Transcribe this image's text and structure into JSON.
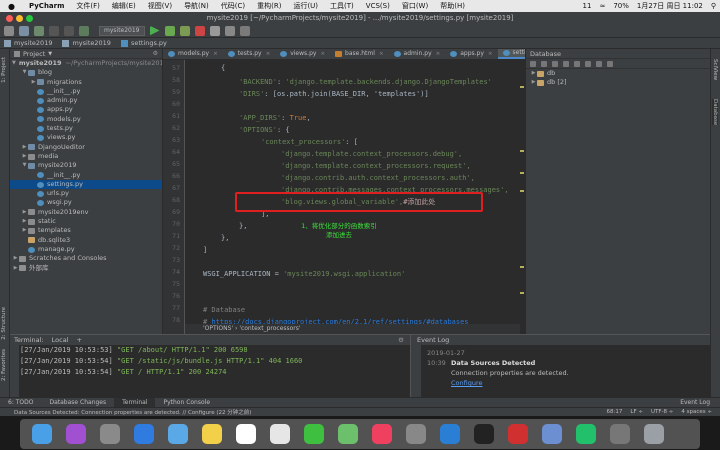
{
  "menubar": {
    "apple": "",
    "app": "PyCharm",
    "items": [
      "文件(F)",
      "编辑(E)",
      "视图(V)",
      "导航(N)",
      "代码(C)",
      "重构(R)",
      "运行(U)",
      "工具(T)",
      "VCS(S)",
      "窗口(W)",
      "帮助(H)"
    ],
    "status": {
      "notifications": "11",
      "battery": "70%",
      "datetime": "1月27日 周日 11:02"
    }
  },
  "window": {
    "title": "mysite2019 [~/PycharmProjects/mysite2019] - .../mysite2019/settings.py [mysite2019]"
  },
  "toolbar": {
    "run_config": "mysite2019"
  },
  "navbar": {
    "crumbs": [
      "mysite2019",
      "mysite2019",
      "settings.py"
    ]
  },
  "project": {
    "header": "Project",
    "rows": [
      {
        "label": "mysite2019",
        "suffix": "~/PycharmProjects/mysite201",
        "indent": 0,
        "arrow": "▼",
        "icon": "folder"
      },
      {
        "label": "blog",
        "indent": 1,
        "arrow": "▼",
        "icon": "pkg"
      },
      {
        "label": "migrations",
        "indent": 2,
        "arrow": "▶",
        "icon": "pkg"
      },
      {
        "label": "__init__.py",
        "indent": 2,
        "arrow": "",
        "icon": "py"
      },
      {
        "label": "admin.py",
        "indent": 2,
        "arrow": "",
        "icon": "py"
      },
      {
        "label": "apps.py",
        "indent": 2,
        "arrow": "",
        "icon": "py"
      },
      {
        "label": "models.py",
        "indent": 2,
        "arrow": "",
        "icon": "py"
      },
      {
        "label": "tests.py",
        "indent": 2,
        "arrow": "",
        "icon": "py"
      },
      {
        "label": "views.py",
        "indent": 2,
        "arrow": "",
        "icon": "py"
      },
      {
        "label": "DjangoUeditor",
        "indent": 1,
        "arrow": "▶",
        "icon": "pkg"
      },
      {
        "label": "media",
        "indent": 1,
        "arrow": "▶",
        "icon": "folder"
      },
      {
        "label": "mysite2019",
        "indent": 1,
        "arrow": "▼",
        "icon": "pkg"
      },
      {
        "label": "__init__.py",
        "indent": 2,
        "arrow": "",
        "icon": "py"
      },
      {
        "label": "settings.py",
        "indent": 2,
        "arrow": "",
        "icon": "py",
        "selected": true
      },
      {
        "label": "urls.py",
        "indent": 2,
        "arrow": "",
        "icon": "py"
      },
      {
        "label": "wsgi.py",
        "indent": 2,
        "arrow": "",
        "icon": "py"
      },
      {
        "label": "mysite2019env",
        "indent": 1,
        "arrow": "▶",
        "icon": "folder"
      },
      {
        "label": "static",
        "indent": 1,
        "arrow": "▶",
        "icon": "folder"
      },
      {
        "label": "templates",
        "indent": 1,
        "arrow": "▶",
        "icon": "folder"
      },
      {
        "label": "db.sqlite3",
        "indent": 1,
        "arrow": "",
        "icon": "db"
      },
      {
        "label": "manage.py",
        "indent": 1,
        "arrow": "",
        "icon": "py"
      },
      {
        "label": "Scratches and Consoles",
        "indent": 0,
        "arrow": "▶",
        "icon": "txt"
      },
      {
        "label": "外部库",
        "indent": 0,
        "arrow": "▶",
        "icon": "txt"
      }
    ]
  },
  "editor": {
    "tabs": [
      "models.py",
      "tests.py",
      "views.py",
      "base.html",
      "admin.py",
      "apps.py",
      "settings.py"
    ],
    "active_tab": 6,
    "line_numbers": [
      "57",
      "58",
      "59",
      "60",
      "61",
      "62",
      "63",
      "64",
      "65",
      "66",
      "67",
      "68",
      "69",
      "70",
      "71",
      "72",
      "73",
      "74",
      "75",
      "76",
      "77",
      "78"
    ],
    "code": {
      "l57": "{",
      "l58_key": "'BACKEND'",
      "l58_val": "'django.template.backends.django.DjangoTemplates'",
      "l59_key": "'DIRS'",
      "l59_val": "[os.path.join(BASE_DIR, 'templates')]",
      "l61_key": "'APP_DIRS'",
      "l61_val": "True",
      "l62_key": "'OPTIONS'",
      "l63_key": "'context_processors'",
      "l64": "'django.template.context_processors.debug',",
      "l65": "'django.template.context_processors.request',",
      "l66": "'django.contrib.auth.context_processors.auth',",
      "l67": "'django.contrib.messages.context_processors.messages',",
      "l68": "'blog.views.global_variable',",
      "l68_comment": "#添加此处",
      "l69": "],",
      "l70": "},",
      "l71": "},",
      "l72": "]",
      "l74_name": "WSGI_APPLICATION",
      "l74_val": "'mysite2019.wsgi.application'",
      "l77": "# Database",
      "l78_prefix": "# ",
      "l78_link": "https://docs.djangoproject.com/en/2.1/ref/settings/#databases"
    },
    "annotation": "1、将优化部分的函数索引\n添加进去",
    "breadcrumb": [
      "'OPTIONS'",
      "'context_processors'"
    ]
  },
  "database": {
    "header": "Database",
    "items": [
      "db",
      "db [2]"
    ]
  },
  "terminal": {
    "header": "Terminal:",
    "tab": "Local",
    "lines": [
      {
        "ts": "[27/Jan/2019 10:53:53]",
        "req": "\"GET /about/ HTTP/1.1\" 200 6598"
      },
      {
        "ts": "[27/Jan/2019 10:53:54]",
        "req": "\"GET /static/js/bundle.js HTTP/1.1\" 404 1660"
      },
      {
        "ts": "[27/Jan/2019 10:53:54]",
        "req": "\"GET / HTTP/1.1\" 200 24274"
      }
    ]
  },
  "eventlog": {
    "header": "Event Log",
    "date": "2019-01-27",
    "time": "10:39",
    "title": "Data Sources Detected",
    "message": "Connection properties are detected.",
    "link": "Configure"
  },
  "bottom_tabs": [
    "6: TODO",
    "Database Changes",
    "Terminal",
    "Python Console"
  ],
  "bottom_right": "Event Log",
  "status": {
    "message": "Data Sources Detected: Connection properties are detected. // Configure (22 分钟之前)",
    "position": "68:17",
    "line_sep": "LF ÷",
    "encoding": "UTF-8 ÷",
    "indent": "4 spaces ÷"
  },
  "side_tabs": {
    "left": [
      "1: Project",
      "2: Structure",
      "2: Favorites"
    ],
    "right": [
      "SciView",
      "Database"
    ]
  },
  "dock_apps": [
    "finder",
    "siri",
    "launchpad",
    "safari",
    "mail",
    "notes",
    "calendar",
    "photos",
    "wechat",
    "maps",
    "music",
    "settings",
    "vscode",
    "terminal",
    "netease",
    "preview",
    "pycharm",
    "other",
    "trash"
  ]
}
